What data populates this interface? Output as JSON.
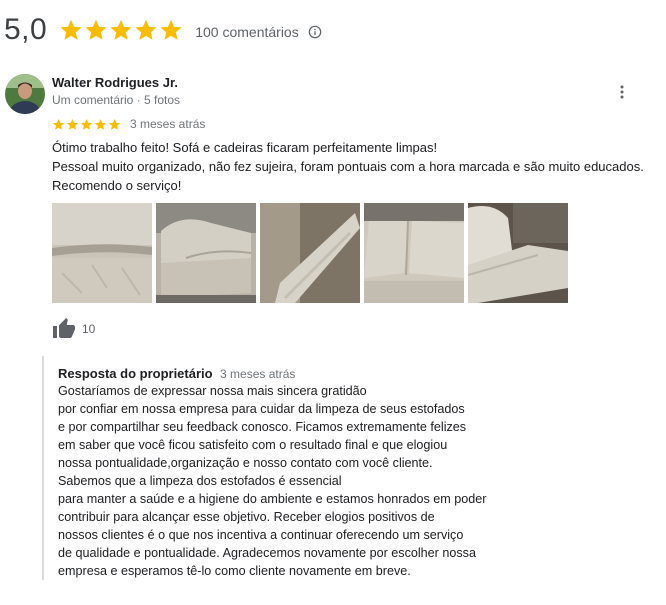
{
  "summary": {
    "score": "5,0",
    "star_count": 5,
    "comment_count": "100 comentários",
    "star_color": "#fbbc04"
  },
  "review": {
    "author": "Walter Rodrigues Jr.",
    "meta": "Um comentário · 5 fotos",
    "rating": 5,
    "time": "3 meses atrás",
    "text_lines": [
      "Ótimo trabalho feito! Sofá e cadeiras ficaram perfeitamente limpas!",
      "Pessoal muito organizado, não fez sujeira, foram pontuais com a hora marcada e são muito educados.",
      "Recomendo o serviço!"
    ],
    "photos": [
      "sofa-cushion-close-up",
      "sofa-side-view",
      "sofa-armrest",
      "sofa-seat",
      "sofa-backrest"
    ],
    "likes": "10"
  },
  "owner_reply": {
    "title": "Resposta do proprietário",
    "time": "3 meses atrás",
    "lines": [
      "Gostaríamos de expressar nossa mais sincera gratidão",
      "por confiar em nossa empresa para cuidar da limpeza de seus estofados",
      "e por compartilhar seu feedback conosco. Ficamos extremamente felizes",
      "em saber que você ficou satisfeito com o resultado final e que elogiou",
      "nossa pontualidade,organização e nosso contato com você cliente.",
      "Sabemos que a limpeza dos estofados é essencial",
      "para manter a saúde e a higiene do ambiente e estamos honrados em poder",
      "contribuir para alcançar esse objetivo. Receber elogios positivos de",
      "nossos clientes é o que nos incentiva a continuar oferecendo um serviço",
      "de qualidade e pontualidade. Agradecemos novamente por escolher nossa",
      "empresa e esperamos tê-lo como cliente novamente em breve."
    ]
  }
}
